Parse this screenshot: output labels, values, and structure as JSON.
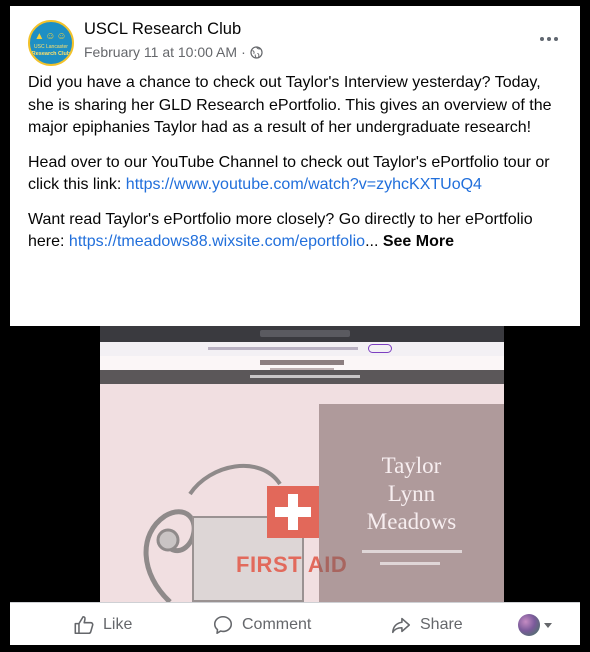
{
  "post": {
    "page_name": "USCL Research Club",
    "date": "February 11 at 10:00 AM",
    "meta_sep": "·",
    "avatar": {
      "line1": "USC Lancaster",
      "line2": "Research Club"
    },
    "paragraphs": {
      "p1": "Did you have a chance to check out Taylor's Interview yesterday? Today, she is sharing her GLD Research ePortfolio. This gives an overview of the major epiphanies Taylor had as a result of her undergraduate research!",
      "p2_text": "Head over to our YouTube Channel to check out Taylor's ePortfolio tour or click this link: ",
      "p2_link": "https://www.youtube.com/watch?v=zyhcKXTUoQ4",
      "p3_text": "Want read Taylor's ePortfolio more closely? Go directly to her ePortfolio here:  ",
      "p3_link": "https://tmeadows88.wixsite.com/eportfolio",
      "ellipsis": "...",
      "see_more": "See More"
    }
  },
  "video": {
    "hero_name": "Taylor\nLynn\nMeadows",
    "first_aid": "FIRST AID"
  },
  "actions": {
    "like": "Like",
    "comment": "Comment",
    "share": "Share"
  },
  "icons": {
    "globe": "globe-icon",
    "more": "more-options-icon",
    "like": "thumbs-up-icon",
    "comment": "comment-bubble-icon",
    "share": "share-arrow-icon",
    "audience": "avatar-dropdown-icon"
  },
  "colors": {
    "link": "#216fdb",
    "secondary_text": "#65676b",
    "avatar_bg": "#1e8fc4",
    "avatar_ring": "#f2c22b",
    "first_aid_red": "#e26a5c"
  }
}
